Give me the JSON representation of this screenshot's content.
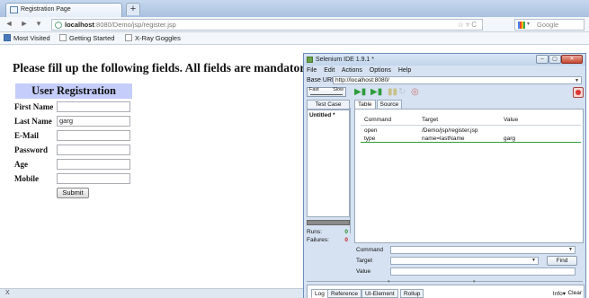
{
  "browser": {
    "tab_title": "Registration Page",
    "new_tab": "+",
    "back": "◄",
    "forward": "►",
    "history": "▾",
    "url_host": "localhost",
    "url_rest": ":8080/Demo/jsp/register.jsp",
    "url_icons": "☆ ▿ C",
    "search_placeholder": "Google",
    "search_dropdown": "▾",
    "bookmarks": [
      "Most Visited",
      "Getting Started",
      "X-Ray Goggles"
    ]
  },
  "page": {
    "heading": "Please fill up the following fields. All fields are mandatory",
    "form_title": "User Registration",
    "fields": [
      {
        "label": "First Name",
        "value": ""
      },
      {
        "label": "Last Name",
        "value": "garg"
      },
      {
        "label": "E-Mail",
        "value": ""
      },
      {
        "label": "Password",
        "value": ""
      },
      {
        "label": "Age",
        "value": ""
      },
      {
        "label": "Mobile",
        "value": ""
      }
    ],
    "submit_label": "Submit",
    "status_text": "X"
  },
  "ide": {
    "title": "Selenium IDE 1.9.1 *",
    "window_buttons": {
      "min": "–",
      "max": "▢",
      "close": "✕"
    },
    "menu": [
      "File",
      "Edit",
      "Actions",
      "Options",
      "Help"
    ],
    "base_url_label": "Base URL",
    "base_url_value": "http://localhost:8080/",
    "base_url_caret": "▼",
    "speed_fast": "Fast",
    "speed_slow": "Slow",
    "toolbar_glyphs": [
      "▶▮",
      "▶▮",
      "▮▮",
      "↻",
      "◎"
    ],
    "test_case_header": "Test Case",
    "test_case_item": "Untitled *",
    "runs_label": "Runs:",
    "runs_value": "0",
    "failures_label": "Failures:",
    "failures_value": "0",
    "editor_tabs": [
      "Table",
      "Source"
    ],
    "columns": [
      "Command",
      "Target",
      "Value"
    ],
    "commands": [
      {
        "command": "open",
        "target": "/Demo/jsp/register.jsp",
        "value": ""
      },
      {
        "command": "type",
        "target": "name=lastName",
        "value": "garg"
      }
    ],
    "command_label": "Command",
    "target_label": "Target",
    "value_label": "Value",
    "find_label": "Find",
    "dropdown_caret": "▼",
    "log_tabs": [
      "Log",
      "Reference",
      "UI-Element",
      "Rollup"
    ],
    "info_label": "Info▾",
    "clear_label": "Clear"
  },
  "colors": {
    "form_title_bg": "#c5cdfa",
    "ide_bg": "#d6e2f1",
    "play_green": "#2e9c3c",
    "record_red": "#d33333",
    "selected_row_underline": "#2e9c3c"
  }
}
